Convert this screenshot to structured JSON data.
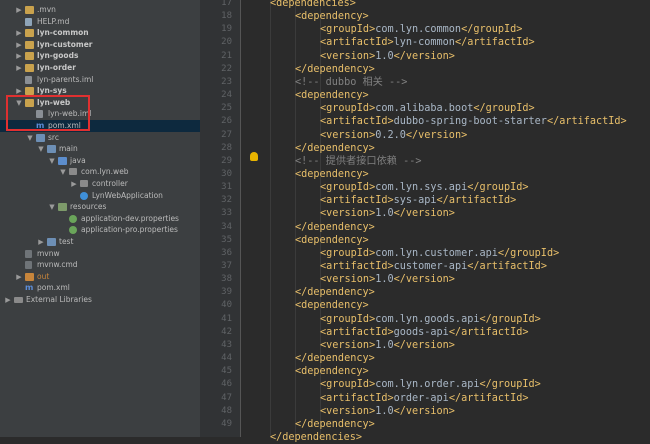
{
  "project_tree": [
    {
      "label": ".mvn",
      "indent": 1,
      "arrow": "▶",
      "icon": "folder",
      "bold": false
    },
    {
      "label": "HELP.md",
      "indent": 1,
      "arrow": "",
      "icon": "file-md",
      "bold": false
    },
    {
      "label": "lyn-common",
      "indent": 1,
      "arrow": "▶",
      "icon": "folder",
      "bold": true
    },
    {
      "label": "lyn-customer",
      "indent": 1,
      "arrow": "▶",
      "icon": "folder",
      "bold": true
    },
    {
      "label": "lyn-goods",
      "indent": 1,
      "arrow": "▶",
      "icon": "folder",
      "bold": true
    },
    {
      "label": "lyn-order",
      "indent": 1,
      "arrow": "▶",
      "icon": "folder",
      "bold": true
    },
    {
      "label": "lyn-parents.iml",
      "indent": 1,
      "arrow": "",
      "icon": "file-iml",
      "bold": false
    },
    {
      "label": "lyn-sys",
      "indent": 1,
      "arrow": "▶",
      "icon": "folder",
      "bold": true
    },
    {
      "label": "lyn-web",
      "indent": 1,
      "arrow": "▼",
      "icon": "folder",
      "bold": true
    },
    {
      "label": "lyn-web.iml",
      "indent": 2,
      "arrow": "",
      "icon": "file-iml",
      "bold": false
    },
    {
      "label": "pom.xml",
      "indent": 2,
      "arrow": "",
      "icon": "file-xml",
      "bold": false,
      "selected": true
    },
    {
      "label": "src",
      "indent": 2,
      "arrow": "▼",
      "icon": "folder src",
      "bold": false
    },
    {
      "label": "main",
      "indent": 3,
      "arrow": "▼",
      "icon": "folder src",
      "bold": false
    },
    {
      "label": "java",
      "indent": 4,
      "arrow": "▼",
      "icon": "folder java",
      "bold": false
    },
    {
      "label": "com.lyn.web",
      "indent": 5,
      "arrow": "▼",
      "icon": "pkg",
      "bold": false
    },
    {
      "label": "controller",
      "indent": 6,
      "arrow": "▶",
      "icon": "pkg",
      "bold": false
    },
    {
      "label": "LynWebApplication",
      "indent": 6,
      "arrow": "",
      "icon": "cls",
      "bold": false
    },
    {
      "label": "resources",
      "indent": 4,
      "arrow": "▼",
      "icon": "folder res",
      "bold": false
    },
    {
      "label": "application-dev.properties",
      "indent": 5,
      "arrow": "",
      "icon": "file-prop",
      "bold": false
    },
    {
      "label": "application-pro.properties",
      "indent": 5,
      "arrow": "",
      "icon": "file-prop",
      "bold": false
    },
    {
      "label": "test",
      "indent": 3,
      "arrow": "▶",
      "icon": "folder src",
      "bold": false
    },
    {
      "label": "mvnw",
      "indent": 1,
      "arrow": "",
      "icon": "file-sh",
      "bold": false
    },
    {
      "label": "mvnw.cmd",
      "indent": 1,
      "arrow": "",
      "icon": "file-sh",
      "bold": false
    },
    {
      "label": "out",
      "indent": 1,
      "arrow": "▶",
      "icon": "folder out",
      "bold": false,
      "orange": true
    },
    {
      "label": "pom.xml",
      "indent": 1,
      "arrow": "",
      "icon": "file-xml",
      "bold": false
    },
    {
      "label": "External Libraries",
      "indent": 0,
      "arrow": "▶",
      "icon": "lib",
      "bold": false
    }
  ],
  "line_numbers": [
    "17",
    "18",
    "19",
    "20",
    "21",
    "22",
    "23",
    "24",
    "25",
    "26",
    "27",
    "28",
    "29",
    "30",
    "31",
    "32",
    "33",
    "34",
    "35",
    "36",
    "37",
    "38",
    "39",
    "40",
    "41",
    "42",
    "43",
    "44",
    "45",
    "46",
    "47",
    "48",
    "49"
  ],
  "code_lines": [
    {
      "indent": 1,
      "parts": [
        [
          "tag",
          "<dependencies>"
        ]
      ]
    },
    {
      "indent": 2,
      "parts": [
        [
          "tag",
          "<dependency>"
        ]
      ]
    },
    {
      "indent": 3,
      "parts": [
        [
          "tag",
          "<groupId>"
        ],
        [
          "txt",
          "com.lyn.common"
        ],
        [
          "tag",
          "</groupId>"
        ]
      ]
    },
    {
      "indent": 3,
      "parts": [
        [
          "tag",
          "<artifactId>"
        ],
        [
          "txt",
          "lyn-common"
        ],
        [
          "tag",
          "</artifactId>"
        ]
      ]
    },
    {
      "indent": 3,
      "parts": [
        [
          "tag",
          "<version>"
        ],
        [
          "txt",
          "1.0"
        ],
        [
          "tag",
          "</version>"
        ]
      ]
    },
    {
      "indent": 2,
      "parts": [
        [
          "tag",
          "</dependency>"
        ]
      ]
    },
    {
      "indent": 2,
      "parts": [
        [
          "cmt",
          "<!-- dubbo 相关 -->"
        ]
      ]
    },
    {
      "indent": 2,
      "parts": [
        [
          "tag",
          "<dependency>"
        ]
      ]
    },
    {
      "indent": 3,
      "parts": [
        [
          "tag",
          "<groupId>"
        ],
        [
          "txt",
          "com.alibaba.boot"
        ],
        [
          "tag",
          "</groupId>"
        ]
      ]
    },
    {
      "indent": 3,
      "parts": [
        [
          "tag",
          "<artifactId>"
        ],
        [
          "txt",
          "dubbo-spring-boot-starter"
        ],
        [
          "tag",
          "</artifactId>"
        ]
      ]
    },
    {
      "indent": 3,
      "parts": [
        [
          "tag",
          "<version>"
        ],
        [
          "txt",
          "0.2.0"
        ],
        [
          "tag",
          "</version>"
        ]
      ]
    },
    {
      "indent": 2,
      "parts": [
        [
          "tag",
          "</dependency>"
        ]
      ]
    },
    {
      "indent": 2,
      "parts": [
        [
          "cmt",
          "<!-- 提供者接口依赖 -->"
        ]
      ]
    },
    {
      "indent": 2,
      "parts": [
        [
          "tag",
          "<dependency>"
        ]
      ]
    },
    {
      "indent": 3,
      "parts": [
        [
          "tag",
          "<groupId>"
        ],
        [
          "txt",
          "com.lyn.sys.api"
        ],
        [
          "tag",
          "</groupId>"
        ]
      ]
    },
    {
      "indent": 3,
      "parts": [
        [
          "tag",
          "<artifactId>"
        ],
        [
          "txt",
          "sys-api"
        ],
        [
          "tag",
          "</artifactId>"
        ]
      ]
    },
    {
      "indent": 3,
      "parts": [
        [
          "tag",
          "<version>"
        ],
        [
          "txt",
          "1.0"
        ],
        [
          "tag",
          "</version>"
        ]
      ]
    },
    {
      "indent": 2,
      "parts": [
        [
          "tag",
          "</dependency>"
        ]
      ]
    },
    {
      "indent": 2,
      "parts": [
        [
          "tag",
          "<dependency>"
        ]
      ]
    },
    {
      "indent": 3,
      "parts": [
        [
          "tag",
          "<groupId>"
        ],
        [
          "txt",
          "com.lyn.customer.api"
        ],
        [
          "tag",
          "</groupId>"
        ]
      ]
    },
    {
      "indent": 3,
      "parts": [
        [
          "tag",
          "<artifactId>"
        ],
        [
          "txt",
          "customer-api"
        ],
        [
          "tag",
          "</artifactId>"
        ]
      ]
    },
    {
      "indent": 3,
      "parts": [
        [
          "tag",
          "<version>"
        ],
        [
          "txt",
          "1.0"
        ],
        [
          "tag",
          "</version>"
        ]
      ]
    },
    {
      "indent": 2,
      "parts": [
        [
          "tag",
          "</dependency>"
        ]
      ]
    },
    {
      "indent": 2,
      "parts": [
        [
          "tag",
          "<dependency>"
        ]
      ]
    },
    {
      "indent": 3,
      "parts": [
        [
          "tag",
          "<groupId>"
        ],
        [
          "txt",
          "com.lyn.goods.api"
        ],
        [
          "tag",
          "</groupId>"
        ]
      ]
    },
    {
      "indent": 3,
      "parts": [
        [
          "tag",
          "<artifactId>"
        ],
        [
          "txt",
          "goods-api"
        ],
        [
          "tag",
          "</artifactId>"
        ]
      ]
    },
    {
      "indent": 3,
      "parts": [
        [
          "tag",
          "<version>"
        ],
        [
          "txt",
          "1.0"
        ],
        [
          "tag",
          "</version>"
        ]
      ]
    },
    {
      "indent": 2,
      "parts": [
        [
          "tag",
          "</dependency>"
        ]
      ]
    },
    {
      "indent": 2,
      "parts": [
        [
          "tag",
          "<dependency>"
        ]
      ]
    },
    {
      "indent": 3,
      "parts": [
        [
          "tag",
          "<groupId>"
        ],
        [
          "txt",
          "com.lyn.order.api"
        ],
        [
          "tag",
          "</groupId>"
        ]
      ]
    },
    {
      "indent": 3,
      "parts": [
        [
          "tag",
          "<artifactId>"
        ],
        [
          "txt",
          "order-api"
        ],
        [
          "tag",
          "</artifactId>"
        ]
      ]
    },
    {
      "indent": 3,
      "parts": [
        [
          "tag",
          "<version>"
        ],
        [
          "txt",
          "1.0"
        ],
        [
          "tag",
          "</version>"
        ]
      ]
    },
    {
      "indent": 2,
      "parts": [
        [
          "tag",
          "</dependency>"
        ]
      ]
    },
    {
      "indent": 1,
      "parts": [
        [
          "tag",
          "</dependencies>"
        ]
      ]
    }
  ]
}
